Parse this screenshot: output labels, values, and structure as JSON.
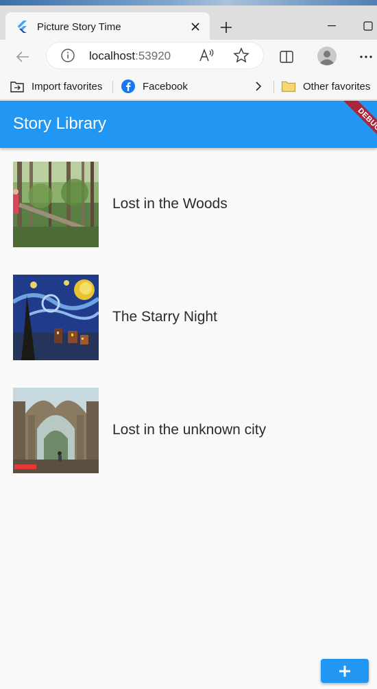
{
  "browser": {
    "tab_title": "Picture Story Time",
    "url_host": "localhost",
    "url_port": ":53920",
    "favorites": {
      "import_label": "Import favorites",
      "facebook_label": "Facebook",
      "other_label": "Other favorites"
    },
    "icons": [
      "flutter-icon",
      "close-icon",
      "plus-icon",
      "minimize-icon",
      "maximize-icon",
      "back-arrow-icon",
      "info-icon",
      "read-aloud-icon",
      "star-icon",
      "split-screen-icon",
      "profile-icon",
      "more-icon",
      "import-icon",
      "facebook-icon",
      "chevron-right-icon",
      "folder-icon"
    ]
  },
  "app": {
    "title": "Story Library",
    "debug_label": "DEBUG",
    "accent_color": "#2196f3",
    "stories": [
      {
        "title": "Lost in the Woods",
        "thumbnail": "forest-image"
      },
      {
        "title": "The Starry Night",
        "thumbnail": "starry-night-image"
      },
      {
        "title": "Lost in the unknown city",
        "thumbnail": "ruined-city-image"
      }
    ],
    "fab_icon": "add-icon"
  }
}
